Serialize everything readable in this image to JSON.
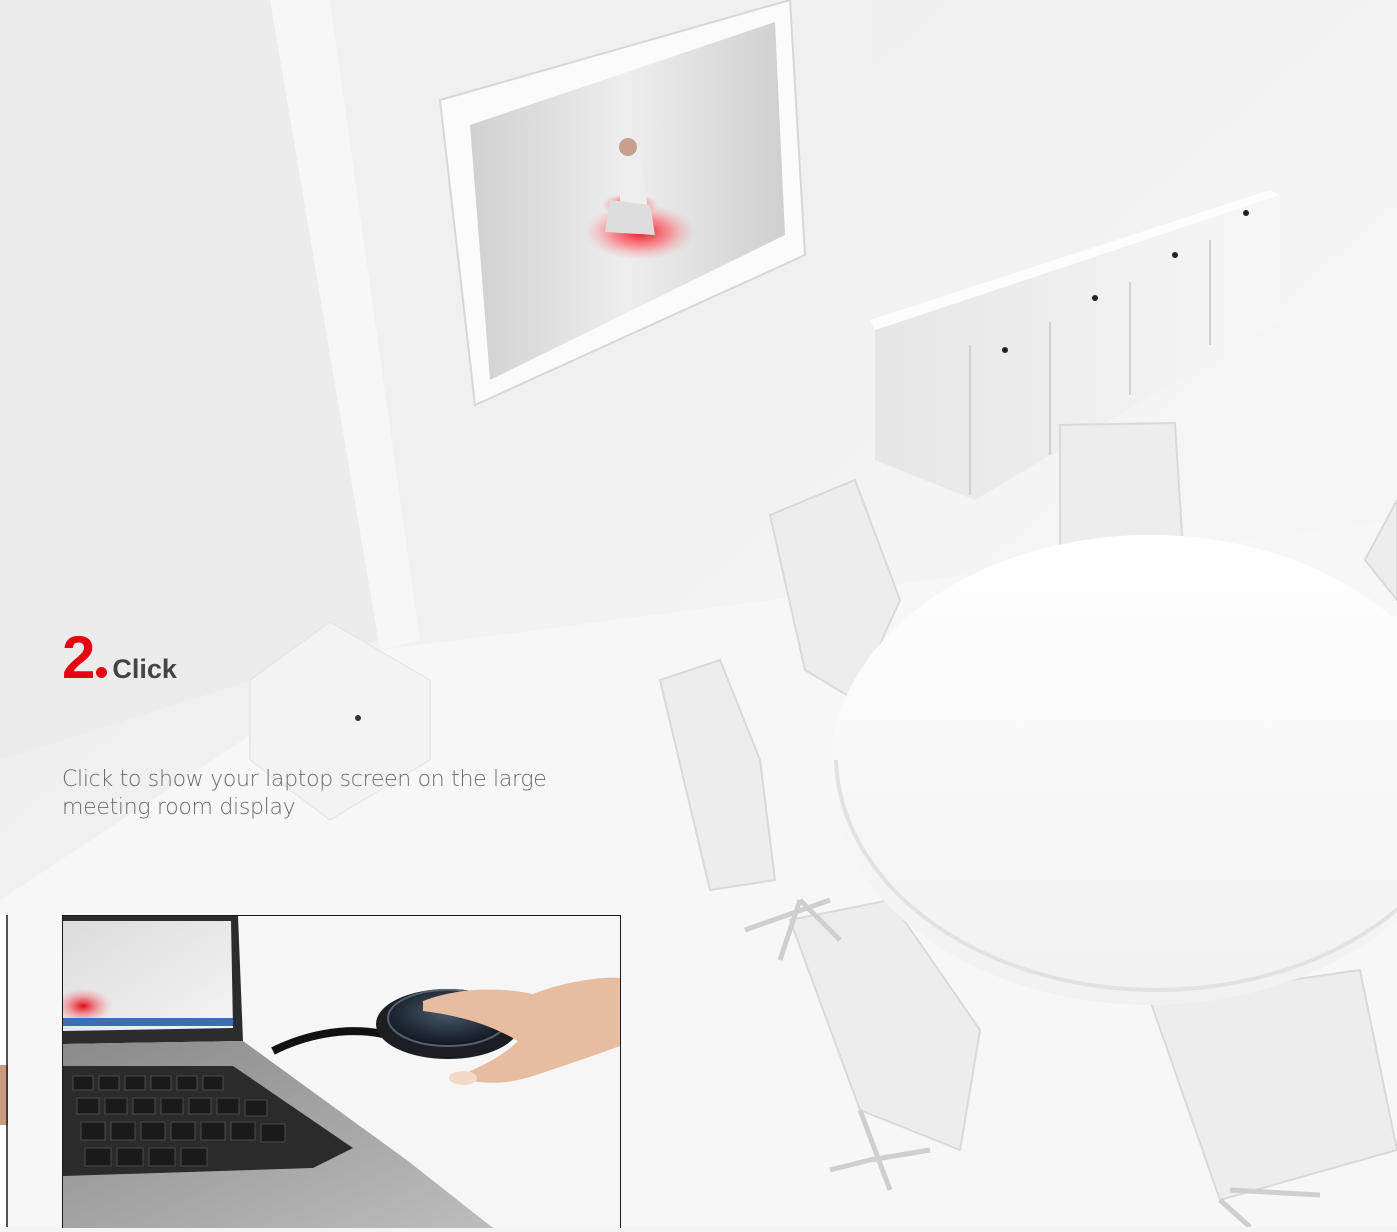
{
  "step": {
    "number": "2",
    "title": "Click",
    "description": "Click to show your laptop screen on the large meeting room display"
  },
  "colors": {
    "accent": "#e30613",
    "wall": "#f4f4f4",
    "text": "#6a6a6a"
  }
}
